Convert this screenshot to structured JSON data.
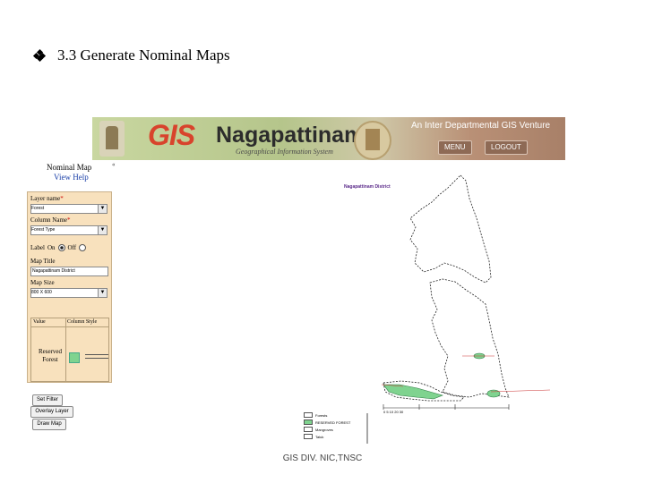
{
  "slide": {
    "title": "3.3 Generate Nominal Maps",
    "footer": "GIS DIV. NIC,TNSC"
  },
  "banner": {
    "gis_text": "GIS",
    "district_text": "Nagapattinam",
    "subtitle": "Geographical Information System",
    "tagline": "An Inter Departmental GIS Venture",
    "menu_label": "MENU",
    "logout_label": "LOGOUT"
  },
  "panel": {
    "heading": "Nominal Map",
    "help_link": "View Help",
    "collapse_glyph": "«",
    "layer_label": "Layer name",
    "layer_value": "Forest",
    "column_label": "Column Name",
    "column_value": "Forest Type",
    "required_mark": "*",
    "label_text": "Label",
    "on_text": "On",
    "off_text": "Off",
    "map_title_label": "Map Title",
    "map_title_value": "Nagapattinam District",
    "map_size_label": "Map Size",
    "map_size_value": "800 X 600",
    "table_head_value": "Value",
    "table_head_style": "Column Style",
    "row_value": "Reserved Forest",
    "set_filter": "Set Filter",
    "overlay_layer": "Overlay Layer",
    "draw_map": "Draw Map"
  },
  "map": {
    "title": "Nagapattinam District",
    "legend": [
      {
        "label": "Forests",
        "color": "#ffffff"
      },
      {
        "label": "RESERVED FOREST",
        "color": "#7fd38f"
      },
      {
        "label": "Mangroves",
        "color": "#ffffff"
      },
      {
        "label": "Taluk",
        "color": "#ffffff"
      }
    ],
    "scale_text": "0 5 10 20 30"
  },
  "colors": {
    "forest_fill": "#7fd38f",
    "boundary": "#222222",
    "form_bg": "#f8e1bd",
    "map_title": "#5b2a8a"
  }
}
